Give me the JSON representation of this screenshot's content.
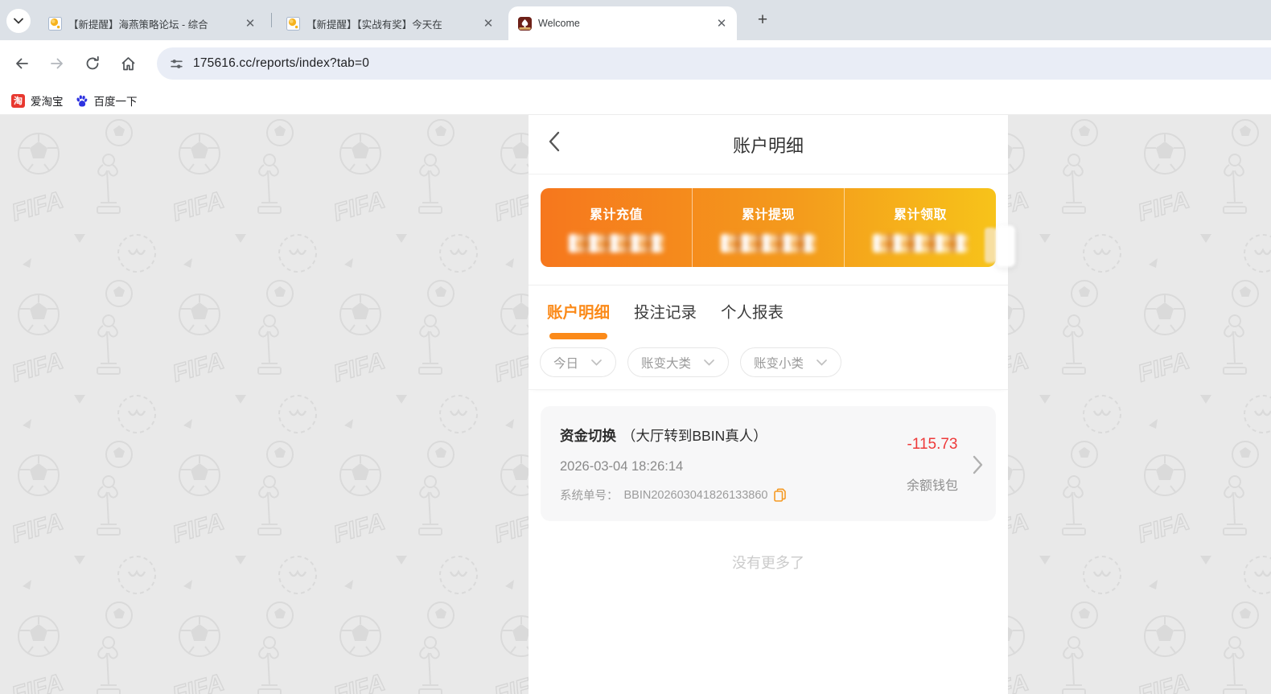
{
  "browser": {
    "tab_search_icon": "chevron-down",
    "tabs": [
      {
        "title": "【新提醒】海燕策略论坛 - 综合",
        "close": "✕",
        "active": false
      },
      {
        "title": "【新提醒】【实战有奖】今天在",
        "close": "✕",
        "active": false
      },
      {
        "title": "Welcome",
        "close": "✕",
        "active": true
      }
    ],
    "newtab_label": "+",
    "url": "175616.cc/reports/index?tab=0",
    "bookmarks": [
      {
        "label": "爱淘宝",
        "icon_glyph": "淘"
      },
      {
        "label": "百度一下"
      }
    ]
  },
  "app": {
    "header": {
      "title": "账户明细"
    },
    "summary": {
      "items": [
        {
          "label": "累计充值",
          "value_state": "blurred"
        },
        {
          "label": "累计提现",
          "value_state": "blurred"
        },
        {
          "label": "累计领取",
          "value_state": "blurred"
        }
      ]
    },
    "tabs": [
      {
        "label": "账户明细",
        "active": true
      },
      {
        "label": "投注记录",
        "active": false
      },
      {
        "label": "个人报表",
        "active": false
      }
    ],
    "filters": [
      {
        "label": "今日"
      },
      {
        "label": "账变大类"
      },
      {
        "label": "账变小类"
      }
    ],
    "transactions": [
      {
        "type": "资金切换",
        "detail": "（大厅转到BBIN真人）",
        "datetime": "2026-03-04 18:26:14",
        "order_label": "系统单号：",
        "order_no": "BBIN202603041826133860",
        "amount": "-115.73",
        "wallet": "余额钱包"
      }
    ],
    "no_more": "没有更多了"
  },
  "colors": {
    "accent_orange": "#fb8a19",
    "card_gradient_left": "#f6771d",
    "card_gradient_right": "#f7c31a",
    "amount_negative": "#ee3a3a",
    "tabstrip_bg": "#dce1e7",
    "addressbar_bg": "#e9edf6",
    "content_bg": "#e9e9e9"
  }
}
